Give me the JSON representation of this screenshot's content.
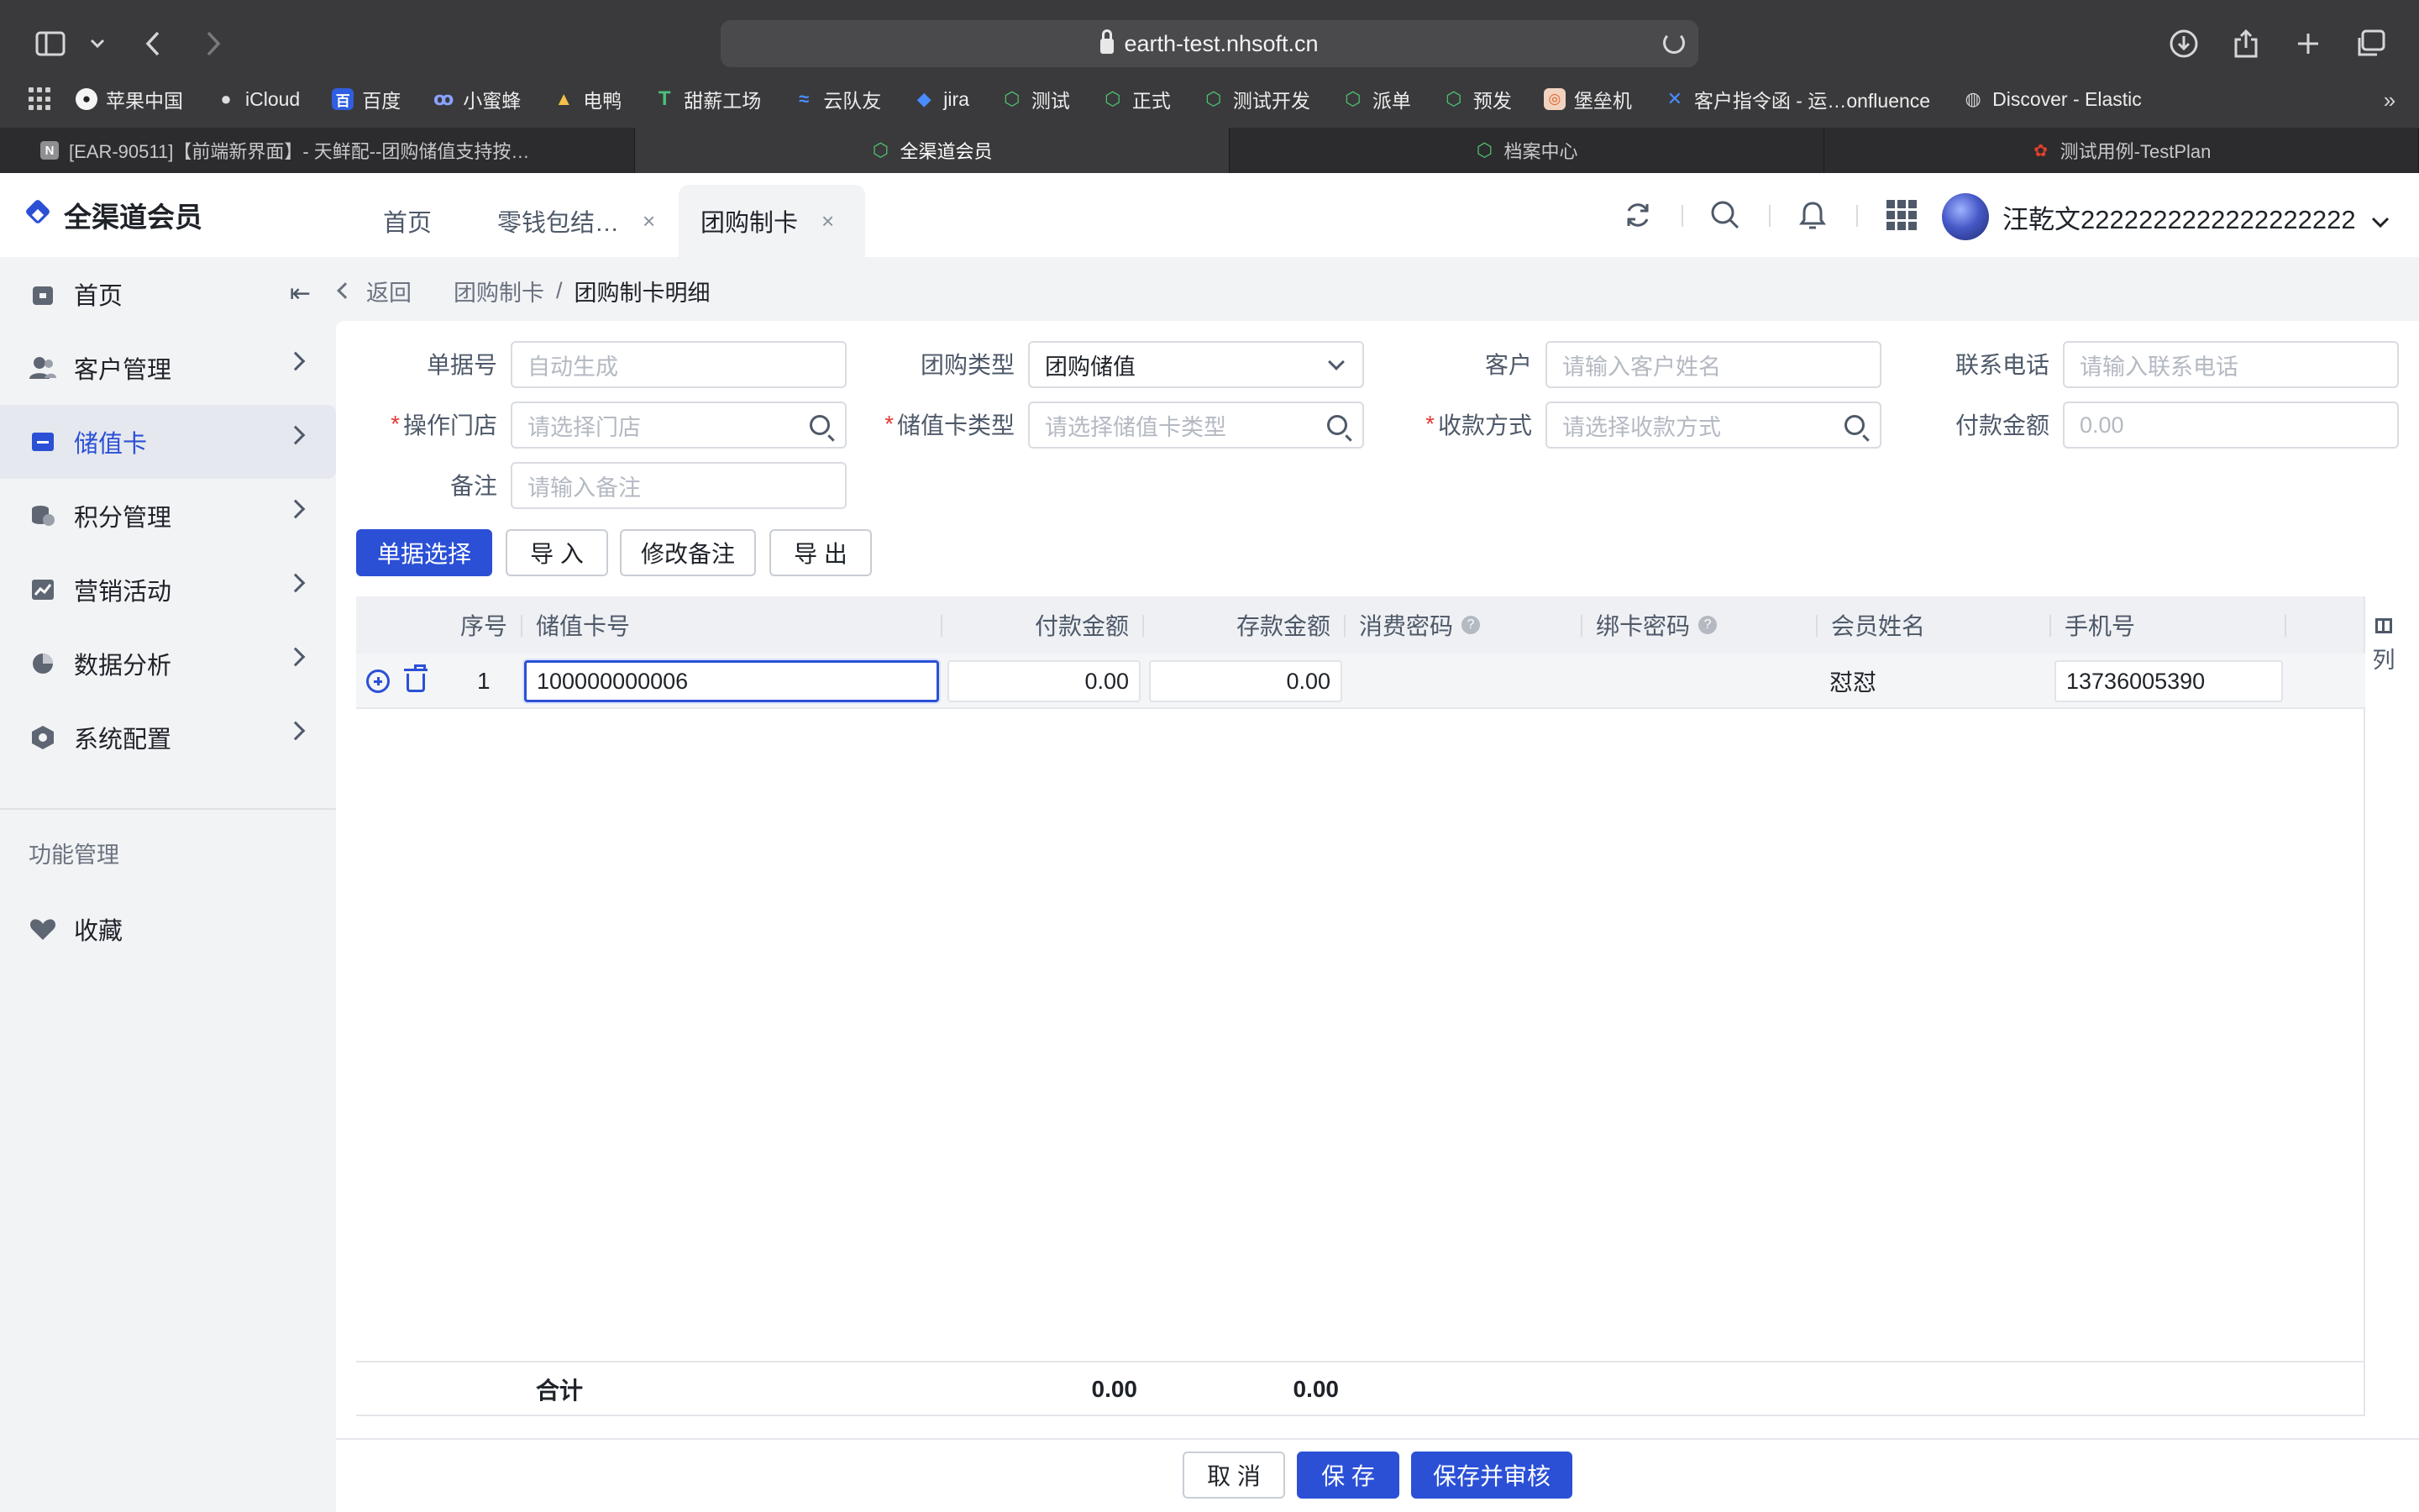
{
  "browser": {
    "url": "earth-test.nhsoft.cn",
    "bookmarks": [
      "苹果中国",
      "iCloud",
      "百度",
      "小蜜蜂",
      "电鸭",
      "甜薪工场",
      "云队友",
      "jira",
      "测试",
      "正式",
      "测试开发",
      "派单",
      "预发",
      "堡垒机",
      "客户指令函 - 运…onfluence",
      "Discover - Elastic"
    ],
    "tabs": [
      "[EAR-90511]【前端新界面】- 天鲜配--团购储值支持按…",
      "全渠道会员",
      "档案中心",
      "测试用例-TestPlan"
    ],
    "active_tab": 1
  },
  "app": {
    "logo": "全渠道会员",
    "tabs": [
      "首页",
      "零钱包结…",
      "团购制卡"
    ],
    "close_mark": "×",
    "username": "汪乾文2222222222222222222"
  },
  "sidebar": {
    "items": [
      "首页",
      "客户管理",
      "储值卡",
      "积分管理",
      "营销活动",
      "数据分析",
      "系统配置"
    ],
    "group": "功能管理",
    "favorites": "收藏"
  },
  "breadcrumb": {
    "back": "返回",
    "parent": "团购制卡",
    "sep": "/",
    "current": "团购制卡明细"
  },
  "form": {
    "doc_no": {
      "label": "单据号",
      "placeholder": "自动生成"
    },
    "group_type": {
      "label": "团购类型",
      "value": "团购储值"
    },
    "customer": {
      "label": "客户",
      "placeholder": "请输入客户姓名"
    },
    "phone": {
      "label": "联系电话",
      "placeholder": "请输入联系电话"
    },
    "store": {
      "label": "操作门店",
      "placeholder": "请选择门店",
      "required_mark": "*"
    },
    "card_type": {
      "label": "储值卡类型",
      "placeholder": "请选择储值卡类型",
      "required_mark": "*"
    },
    "pay_method": {
      "label": "收款方式",
      "placeholder": "请选择收款方式",
      "required_mark": "*"
    },
    "pay_amount": {
      "label": "付款金额",
      "placeholder": "0.00"
    },
    "remark": {
      "label": "备注",
      "placeholder": "请输入备注"
    }
  },
  "actions": {
    "select_doc": "单据选择",
    "import": "导 入",
    "edit_remark": "修改备注",
    "export": "导 出"
  },
  "table": {
    "columns": {
      "index": "序号",
      "card_no": "储值卡号",
      "pay_amount": "付款金额",
      "deposit_amount": "存款金额",
      "consume_pwd": "消费密码",
      "bind_pwd": "绑卡密码",
      "member_name": "会员姓名",
      "mobile": "手机号"
    },
    "help_mark": "?",
    "column_setting": "列",
    "rows": [
      {
        "index": "1",
        "card_no": "100000000006",
        "pay_amount": "0.00",
        "deposit_amount": "0.00",
        "consume_pwd": "",
        "bind_pwd": "",
        "member_name": "怼怼",
        "mobile": "13736005390"
      }
    ],
    "footer": {
      "label": "合计",
      "pay_total": "0.00",
      "deposit_total": "0.00"
    }
  },
  "footer_buttons": {
    "cancel": "取 消",
    "save": "保 存",
    "save_audit": "保存并审核"
  },
  "colors": {
    "primary": "#2b50d6",
    "required": "#e53935",
    "chrome": "#3a3a3c"
  }
}
